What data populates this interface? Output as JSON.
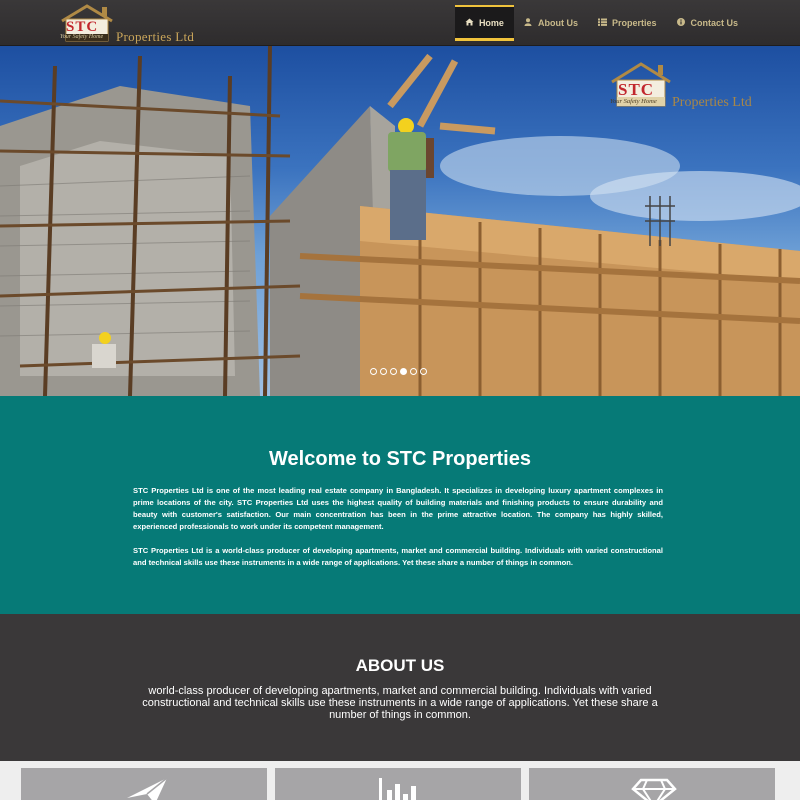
{
  "brand": {
    "initials": "STC",
    "tagline": "Your Safety Home",
    "wordmark": "Properties Ltd",
    "colors": {
      "nav_bg": "#343233",
      "accent": "#f0c33c",
      "teal": "#067a77",
      "dark": "#3a3839"
    }
  },
  "nav": {
    "items": [
      {
        "label": "Home",
        "icon": "home-icon",
        "active": true
      },
      {
        "label": "About Us",
        "icon": "user-icon",
        "active": false
      },
      {
        "label": "Properties",
        "icon": "list-icon",
        "active": false
      },
      {
        "label": "Contact Us",
        "icon": "info-icon",
        "active": false
      }
    ]
  },
  "hero": {
    "image": "construction-site-photo",
    "slides_total": 6,
    "active_slide": 4
  },
  "welcome": {
    "title": "Welcome to STC Properties",
    "paragraph1": "STC Properties Ltd is one of the most leading real estate company in Bangladesh. It specializes in developing luxury apartment complexes in prime locations of the city. STC Properties Ltd uses the highest quality of building materials and finishing products to ensure durability and beauty with customer's satisfaction. Our main concentration has been in the prime attractive location. The company has highly skilled, experienced professionals to work under its competent management.",
    "paragraph2": "STC Properties Ltd is a world-class producer of developing apartments, market and commercial building. Individuals with varied constructional and technical skills use these instruments in a wide range of applications. Yet these share a number of things in common."
  },
  "about": {
    "title": "ABOUT US",
    "text": "world-class producer of developing apartments, market and commercial building. Individuals with varied constructional and technical skills use these instruments in a wide range of applications. Yet these share a number of things in common."
  },
  "features": [
    {
      "icon": "paper-plane-icon"
    },
    {
      "icon": "bar-chart-icon"
    },
    {
      "icon": "diamond-icon"
    }
  ]
}
